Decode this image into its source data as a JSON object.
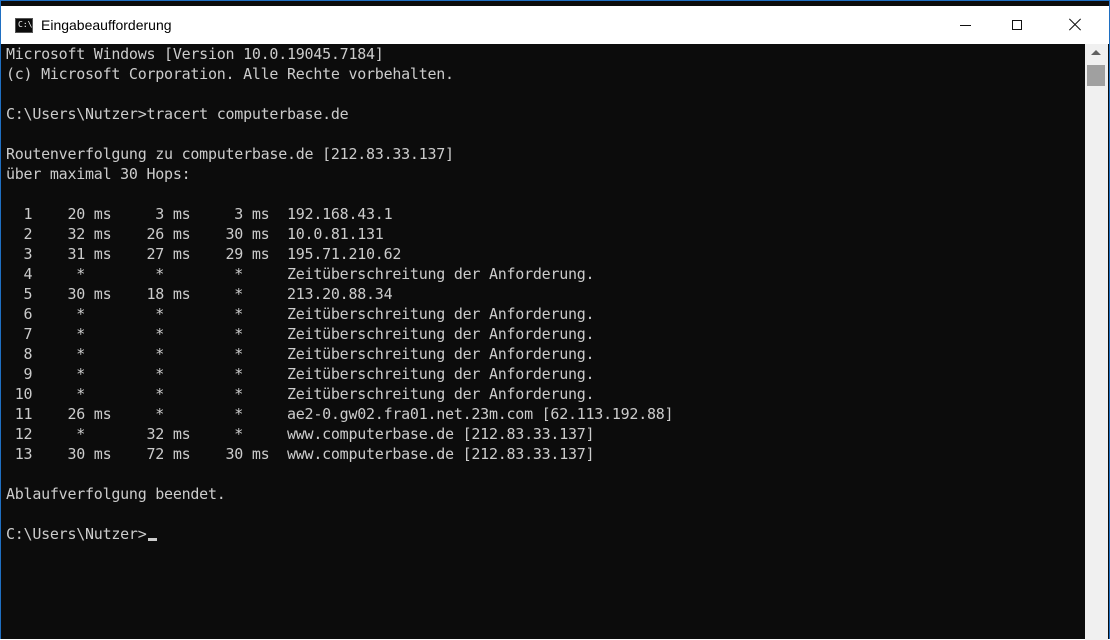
{
  "window": {
    "title": "Eingabeaufforderung",
    "icon": "console-icon",
    "icon_glyph": "C:\\."
  },
  "console": {
    "lines": [
      "Microsoft Windows [Version 10.0.19045.7184]",
      "(c) Microsoft Corporation. Alle Rechte vorbehalten.",
      "",
      "C:\\Users\\Nutzer>tracert computerbase.de",
      "",
      "Routenverfolgung zu computerbase.de [212.83.33.137]",
      "über maximal 30 Hops:",
      "",
      "  1    20 ms     3 ms     3 ms  192.168.43.1",
      "  2    32 ms    26 ms    30 ms  10.0.81.131",
      "  3    31 ms    27 ms    29 ms  195.71.210.62",
      "  4     *        *        *     Zeitüberschreitung der Anforderung.",
      "  5    30 ms    18 ms     *     213.20.88.34",
      "  6     *        *        *     Zeitüberschreitung der Anforderung.",
      "  7     *        *        *     Zeitüberschreitung der Anforderung.",
      "  8     *        *        *     Zeitüberschreitung der Anforderung.",
      "  9     *        *        *     Zeitüberschreitung der Anforderung.",
      " 10     *        *        *     Zeitüberschreitung der Anforderung.",
      " 11    26 ms     *        *     ae2-0.gw02.fra01.net.23m.com [62.113.192.88]",
      " 12     *       32 ms     *     www.computerbase.de [212.83.33.137]",
      " 13    30 ms    72 ms    30 ms  www.computerbase.de [212.83.33.137]",
      "",
      "Ablaufverfolgung beendet.",
      "",
      "C:\\Users\\Nutzer>"
    ]
  },
  "colors": {
    "console_bg": "#0c0c0c",
    "console_fg": "#cccccc",
    "titlebar_bg": "#ffffff",
    "window_border": "#1f6fc2"
  }
}
